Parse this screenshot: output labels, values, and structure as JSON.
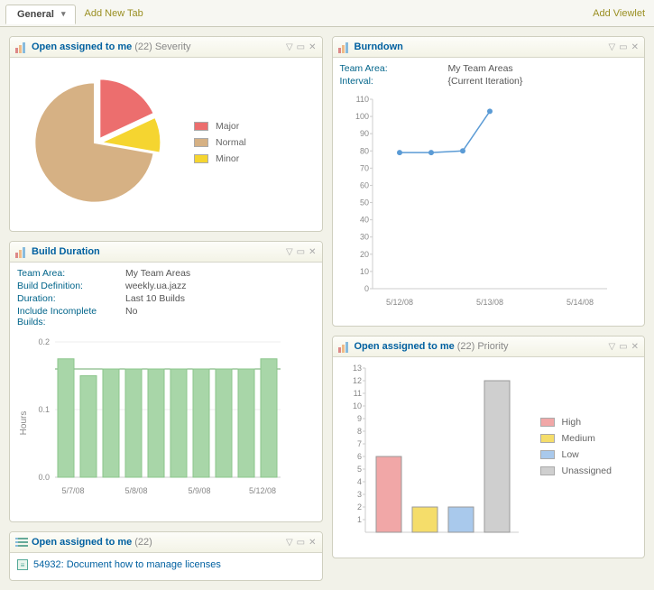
{
  "tabs": {
    "active": "General",
    "add_tab_label": "Add New Tab",
    "add_viewlet_label": "Add Viewlet"
  },
  "severity": {
    "title": "Open assigned to me",
    "count": "(22)",
    "sub": "Severity",
    "legend": [
      "Major",
      "Normal",
      "Minor"
    ]
  },
  "build": {
    "title": "Build Duration",
    "meta": {
      "team_area_k": "Team Area:",
      "team_area_v": "My Team Areas",
      "def_k": "Build Definition:",
      "def_v": "weekly.ua.jazz",
      "dur_k": "Duration:",
      "dur_v": "Last 10 Builds",
      "inc_k": "Include Incomplete Builds:",
      "inc_v": "No"
    },
    "ylabel": "Hours",
    "xticks": [
      "5/7/08",
      "5/8/08",
      "5/9/08",
      "5/12/08"
    ],
    "yticks": [
      "0.0",
      "0.1",
      "0.2"
    ]
  },
  "workitems": {
    "title": "Open assigned to me",
    "count": "(22)",
    "items": [
      "54932: Document how to manage licenses"
    ]
  },
  "burndown": {
    "title": "Burndown",
    "meta": {
      "team_area_k": "Team Area:",
      "team_area_v": "My Team Areas",
      "interval_k": "Interval:",
      "interval_v": "{Current Iteration}"
    },
    "yticks": [
      "0",
      "10",
      "20",
      "30",
      "40",
      "50",
      "60",
      "70",
      "80",
      "90",
      "100",
      "110"
    ],
    "xticks": [
      "5/12/08",
      "5/13/08",
      "5/14/08"
    ]
  },
  "priority": {
    "title": "Open assigned to me",
    "count": "(22)",
    "sub": "Priority",
    "legend": [
      "High",
      "Medium",
      "Low",
      "Unassigned"
    ],
    "yticks": [
      "1",
      "2",
      "3",
      "4",
      "5",
      "6",
      "7",
      "8",
      "9",
      "10",
      "11",
      "12",
      "13"
    ]
  },
  "chart_data": [
    {
      "id": "severity-pie",
      "type": "pie",
      "title": "Open assigned to me (22) Severity",
      "series": [
        {
          "name": "Major",
          "value": 4,
          "color": "#e66"
        },
        {
          "name": "Normal",
          "value": 16,
          "color": "#d6b184"
        },
        {
          "name": "Minor",
          "value": 2,
          "color": "#f4d321"
        }
      ]
    },
    {
      "id": "build-duration",
      "type": "bar",
      "title": "Build Duration",
      "ylabel": "Hours",
      "ylim": [
        0,
        0.2
      ],
      "categories": [
        "5/7/08 a",
        "5/7/08 b",
        "5/7/08 c",
        "5/8/08 a",
        "5/8/08 b",
        "5/8/08 c",
        "5/9/08 a",
        "5/9/08 b",
        "5/9/08 c",
        "5/12/08"
      ],
      "values": [
        0.175,
        0.15,
        0.16,
        0.16,
        0.16,
        0.16,
        0.16,
        0.16,
        0.16,
        0.175
      ],
      "xtick_positions": [
        "5/7/08",
        "5/8/08",
        "5/9/08",
        "5/12/08"
      ]
    },
    {
      "id": "burndown",
      "type": "line",
      "title": "Burndown",
      "ylim": [
        0,
        110
      ],
      "x": [
        "5/12/08",
        "5/12/08+",
        "5/13/08-",
        "5/13/08"
      ],
      "values": [
        79,
        79,
        80,
        103
      ],
      "xtick_positions": [
        "5/12/08",
        "5/13/08",
        "5/14/08"
      ]
    },
    {
      "id": "priority-bar",
      "type": "bar",
      "title": "Open assigned to me (22) Priority",
      "ylim": [
        0,
        13
      ],
      "series": [
        {
          "name": "High",
          "value": 6,
          "color": "#f1a7a7"
        },
        {
          "name": "Medium",
          "value": 2,
          "color": "#f5dd6a"
        },
        {
          "name": "Low",
          "value": 2,
          "color": "#a9c9ec"
        },
        {
          "name": "Unassigned",
          "value": 12,
          "color": "#cfcfcf"
        }
      ]
    }
  ]
}
